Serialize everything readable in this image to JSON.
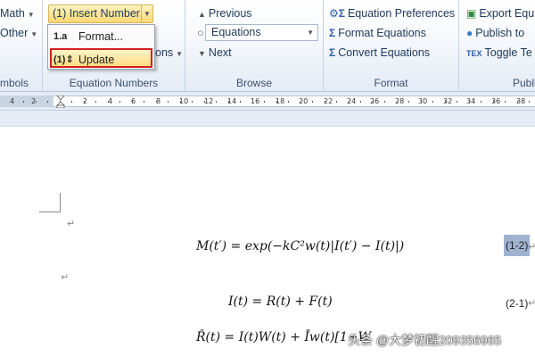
{
  "ribbon": {
    "col1": {
      "math_label": "Math",
      "other_label": "Other",
      "group_label": "mbols"
    },
    "equation_numbers": {
      "insert_number_label": "(1) Insert Number",
      "group_label": "Equation Numbers",
      "hidden_label": "ons"
    },
    "dropdown": {
      "items": [
        {
          "icon": "1.a",
          "label": "Format..."
        },
        {
          "icon": "(1)⇕",
          "label": "Update"
        }
      ]
    },
    "browse": {
      "previous_label": "Previous",
      "select_value": "Equations",
      "next_label": "Next",
      "group_label": "Browse"
    },
    "format": {
      "prefs_label": "Equation Preferences",
      "format_label": "Format Equations",
      "convert_label": "Convert Equations",
      "group_label": "Format"
    },
    "publish": {
      "export_label": "Export Equ",
      "publish_label": "Publish to",
      "toggle_label": "Toggle Te",
      "group_label": "Publi"
    }
  },
  "ruler": {
    "ticks": [
      "4",
      "2",
      "2",
      "4",
      "6",
      "8",
      "10",
      "12",
      "14",
      "16",
      "18",
      "20",
      "22",
      "24",
      "26",
      "28",
      "30",
      "32",
      "34",
      "36",
      "38"
    ]
  },
  "document": {
    "paragraph_mark": "↵",
    "equations": [
      {
        "text": "M(t′) = exp(−kC²w(t)|I(t′) − I(t)|)",
        "number": "(1-2)"
      },
      {
        "text": "I(t) = R(t) + F(t)",
        "number": "(2-1)"
      },
      {
        "text": "R̂(t) = I(t)W(t) + Īw(t)[1−W",
        "number": ""
      }
    ],
    "watermark": "头条 @大梦初醒209356965"
  }
}
